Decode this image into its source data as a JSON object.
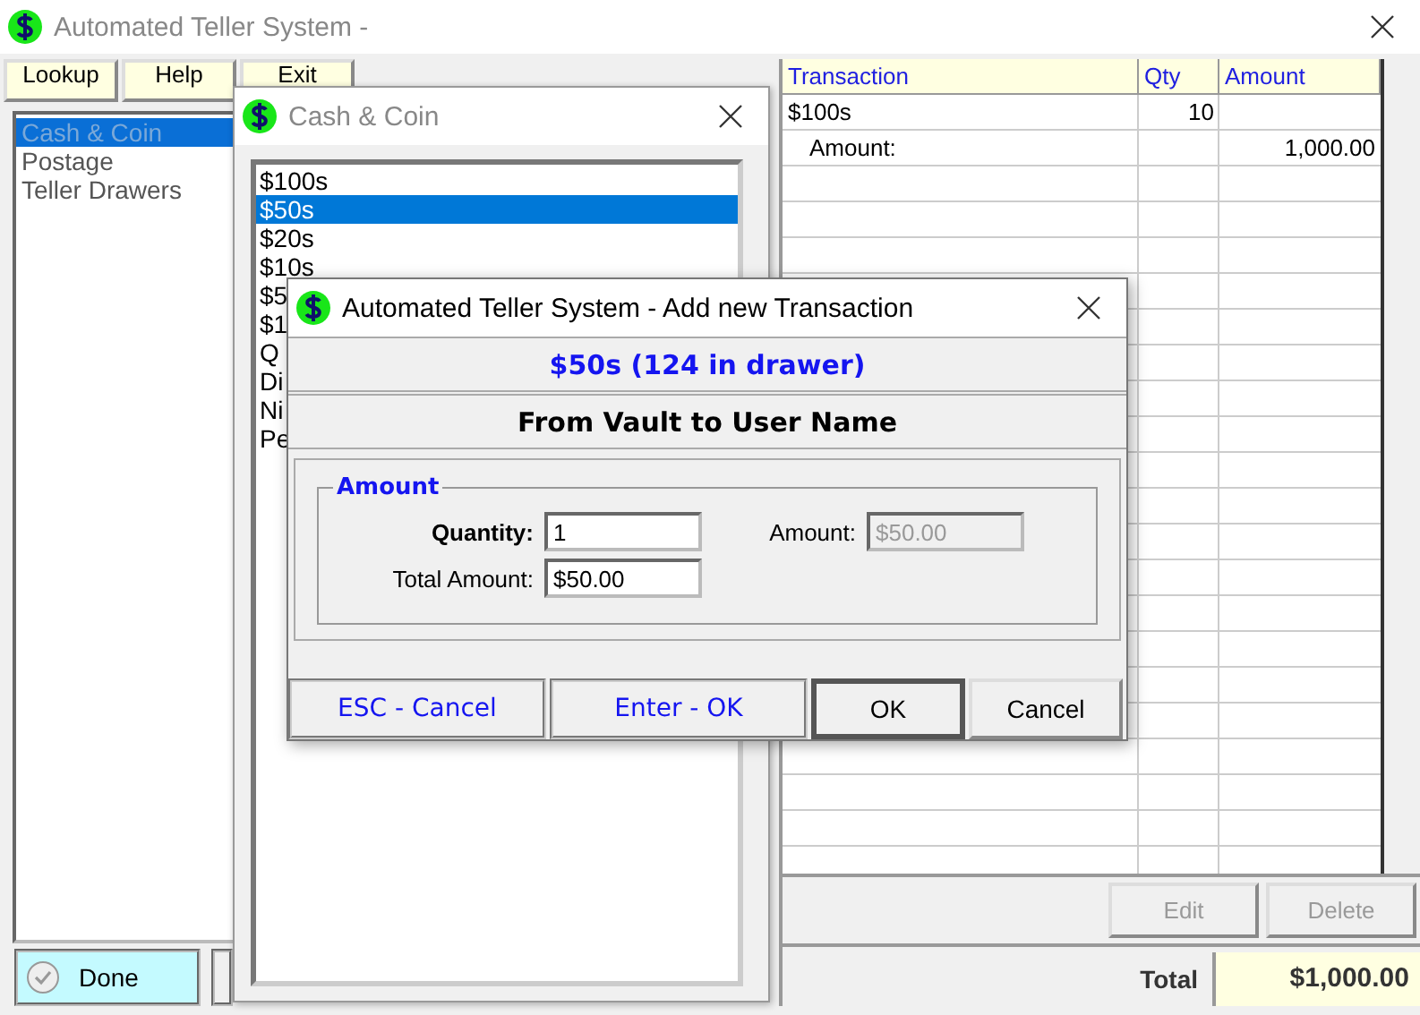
{
  "window": {
    "title": "Automated Teller System -"
  },
  "menu_tabs": [
    {
      "label": "Lookup"
    },
    {
      "label": "Help"
    },
    {
      "label": "Exit"
    }
  ],
  "categories": [
    {
      "label": "Cash & Coin",
      "selected": true
    },
    {
      "label": "Postage",
      "selected": false
    },
    {
      "label": "Teller Drawers",
      "selected": false
    }
  ],
  "done_button": {
    "label": "Done"
  },
  "cash_window": {
    "title": "Cash & Coin",
    "items": [
      {
        "label": "$100s",
        "selected": false
      },
      {
        "label": "$50s",
        "selected": true
      },
      {
        "label": "$20s",
        "selected": false
      },
      {
        "label": "$10s",
        "selected": false
      },
      {
        "label": "$5",
        "selected": false
      },
      {
        "label": "$1",
        "selected": false
      },
      {
        "label": "Q",
        "selected": false
      },
      {
        "label": "Di",
        "selected": false
      },
      {
        "label": "Ni",
        "selected": false
      },
      {
        "label": "Pe",
        "selected": false
      }
    ]
  },
  "dialog": {
    "title": "Automated Teller System - Add new Transaction",
    "heading": "$50s (124 in drawer)",
    "subheading": "From Vault to User Name",
    "group_label": "Amount",
    "quantity": {
      "label": "Quantity:",
      "value": "1",
      "disabled": false
    },
    "amount": {
      "label": "Amount:",
      "value": "$50.00",
      "disabled": true
    },
    "total_amount": {
      "label": "Total Amount:",
      "value": "$50.00",
      "disabled": false
    },
    "hints": [
      "ESC - Cancel",
      "Enter - OK"
    ],
    "buttons": [
      {
        "label": "OK",
        "default": true
      },
      {
        "label": "Cancel",
        "default": false
      }
    ]
  },
  "table": {
    "columns": [
      "Transaction",
      "Qty",
      "Amount"
    ],
    "rows": [
      {
        "kind": "item",
        "transaction": "$100s",
        "qty": "10"
      },
      {
        "kind": "detail",
        "transaction": "Amount:",
        "amount": "1,000.00"
      }
    ]
  },
  "edit_button": {
    "label": "Edit",
    "disabled": true
  },
  "delete_button": {
    "label": "Delete",
    "disabled": true
  },
  "total": {
    "label": "Total",
    "value": "$1,000.00"
  }
}
